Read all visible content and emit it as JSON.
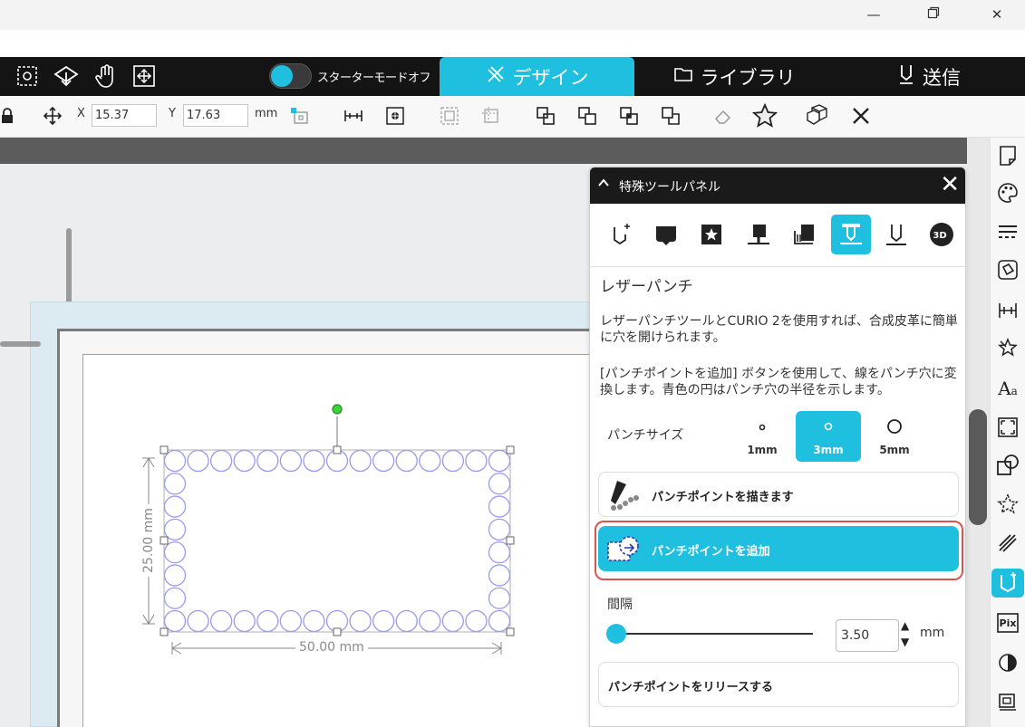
{
  "window": {
    "minimize_icon": "minimize-icon",
    "restore_icon": "restore-icon",
    "close_icon": "close-icon"
  },
  "nav": {
    "toggle_label": "スターターモードオフ",
    "tabs": [
      {
        "label": "デザイン",
        "icon": "design-icon",
        "active": true
      },
      {
        "label": "ライブラリ",
        "icon": "folder-icon",
        "active": false
      },
      {
        "label": "送信",
        "icon": "send-icon",
        "active": false
      }
    ]
  },
  "toolbar": {
    "x_label": "X",
    "x_value": "15.37",
    "y_label": "Y",
    "y_value": "17.63",
    "unit": "mm"
  },
  "canvas": {
    "width_dim": "50.00 mm",
    "height_dim": "25.00 mm"
  },
  "panel": {
    "title": "特殊ツールパネル",
    "tool_name": "レザーパンチ",
    "desc1": "レザーパンチツールとCURIO 2を使用すれば、合成皮革に簡単に穴を開けられます。",
    "desc2": "[パンチポイントを追加] ボタンを使用して、線をパンチ穴に変換します。青色の円はパンチ穴の半径を示します。",
    "punch_size_label": "パンチサイズ",
    "sizes": [
      {
        "label": "1mm",
        "active": false
      },
      {
        "label": "3mm",
        "active": true
      },
      {
        "label": "5mm",
        "active": false
      }
    ],
    "draw_button": "パンチポイントを描きます",
    "add_button": "パンチポイントを追加",
    "spacing_label": "間隔",
    "spacing_value": "3.50",
    "spacing_unit": "mm",
    "release_button": "パンチポイントをリリースする"
  },
  "colors": {
    "accent": "#1fbfe0",
    "highlight": "#d9534f",
    "punch_circle": "#9a9af0"
  }
}
